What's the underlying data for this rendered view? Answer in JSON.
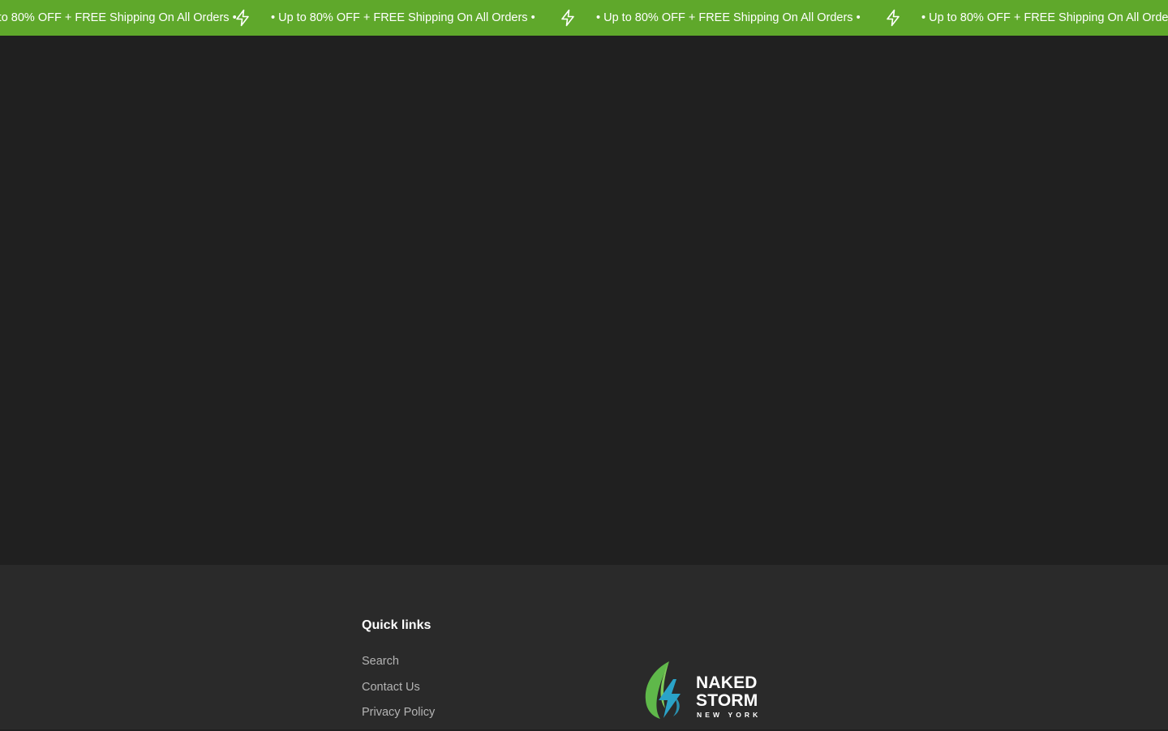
{
  "announcement": {
    "message": "• Up to 80% OFF + FREE Shipping On All Orders •",
    "background_color": "#5fa82b",
    "icon": "lightning-bolt-icon"
  },
  "footer": {
    "quick_links": {
      "heading": "Quick links",
      "links": [
        {
          "label": "Search"
        },
        {
          "label": "Contact Us"
        },
        {
          "label": "Privacy Policy"
        }
      ]
    },
    "logo": {
      "line1": "NAKED",
      "line2": "STORM",
      "line3": "NEW YORK"
    }
  },
  "colors": {
    "page_background": "#202020",
    "footer_background": "#2a2a2a",
    "leaf_green": "#5fb84a",
    "bolt_teal": "#2aa3c8"
  }
}
